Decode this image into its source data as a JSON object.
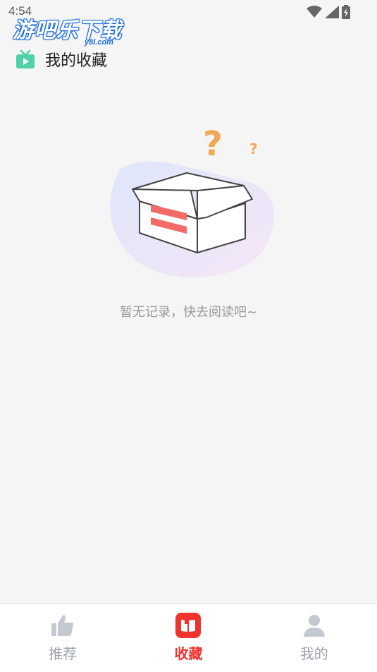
{
  "status": {
    "time": "4:54"
  },
  "watermark": {
    "text": "游吧乐下载",
    "sub": "y8l.com"
  },
  "header": {
    "title": "我的收藏",
    "icon": "tv-icon"
  },
  "empty": {
    "message": "暂无记录，快去阅读吧~",
    "illustration": "empty-box-question-icon"
  },
  "tabs": [
    {
      "label": "推荐",
      "icon": "thumbs-up-icon",
      "active": false
    },
    {
      "label": "收藏",
      "icon": "book-icon",
      "active": true
    },
    {
      "label": "我的",
      "icon": "user-icon",
      "active": false
    }
  ],
  "colors": {
    "accent": "#f0332e",
    "inactive": "#9aa0ac",
    "background": "#f5f5f5",
    "tv_icon": "#4fd2a8"
  }
}
